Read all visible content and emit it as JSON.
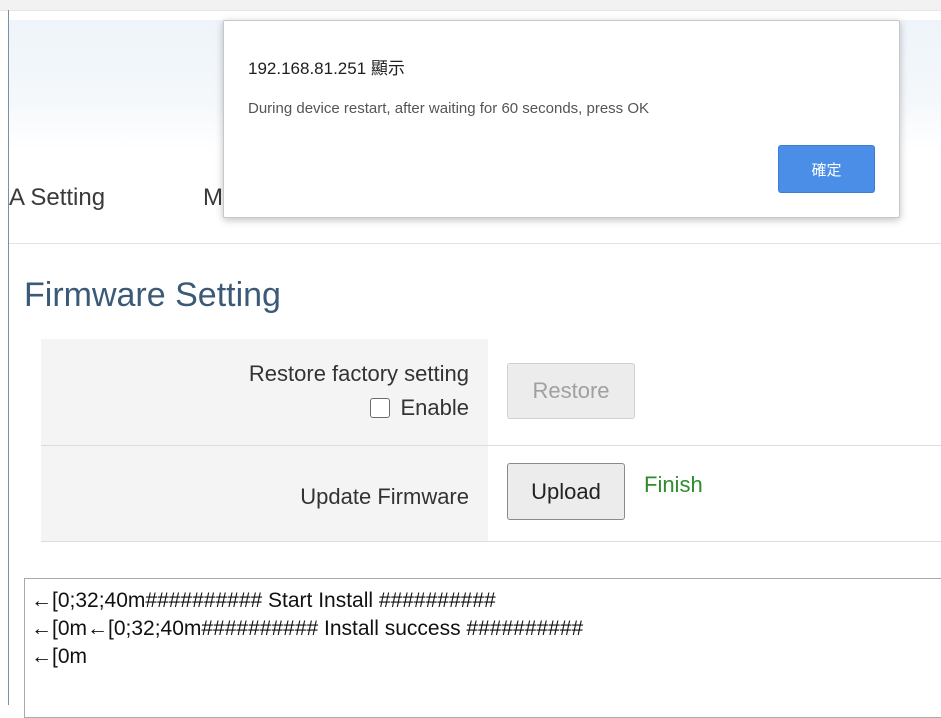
{
  "nav": {
    "items": [
      "A Setting",
      "M"
    ]
  },
  "page": {
    "title": "Firmware Setting"
  },
  "form": {
    "restore": {
      "label": "Restore factory setting",
      "checkbox_label": "Enable",
      "checkbox_checked": false,
      "button": "Restore",
      "button_disabled": true
    },
    "update": {
      "label": "Update Firmware",
      "button": "Upload",
      "status": "Finish"
    }
  },
  "log": {
    "lines": [
      "←[0;32;40m########## Start Install ##########",
      "←[0m←[0;32;40m########## Install success ##########",
      "←[0m"
    ]
  },
  "dialog": {
    "title": "192.168.81.251 顯示",
    "message": "During device restart, after waiting for 60 seconds, press OK",
    "ok_label": "確定"
  },
  "colors": {
    "title": "#3b5a78",
    "status_ok": "#2e8b2e",
    "dialog_button": "#4a8ee8"
  }
}
